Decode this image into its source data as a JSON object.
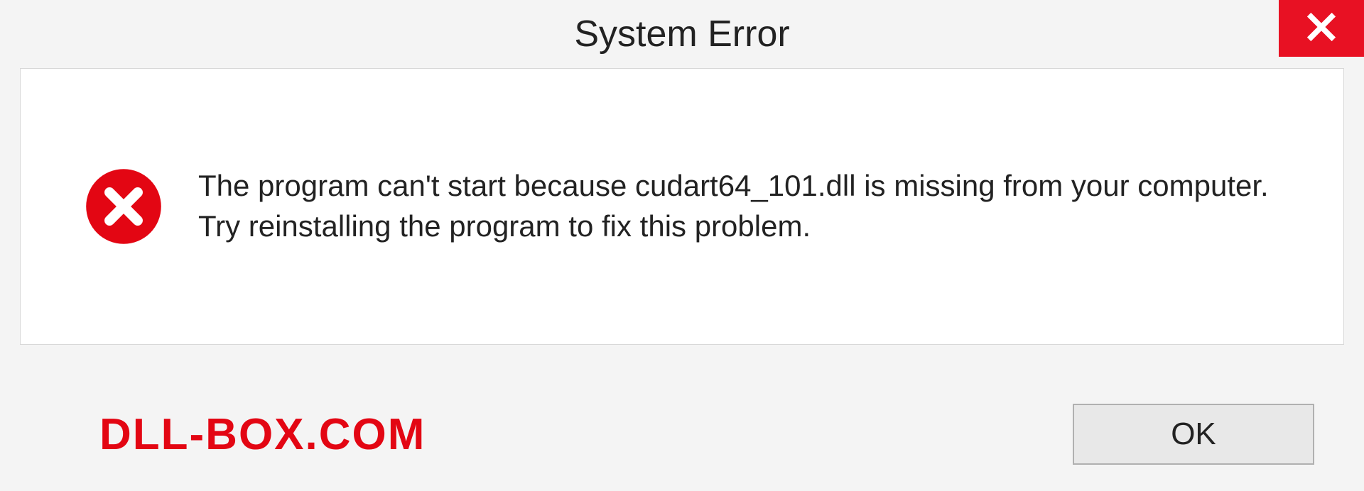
{
  "dialog": {
    "title": "System Error",
    "message": "The program can't start because cudart64_101.dll is missing from your computer. Try reinstalling the program to fix this problem.",
    "ok_label": "OK"
  },
  "watermark": "DLL-BOX.COM"
}
